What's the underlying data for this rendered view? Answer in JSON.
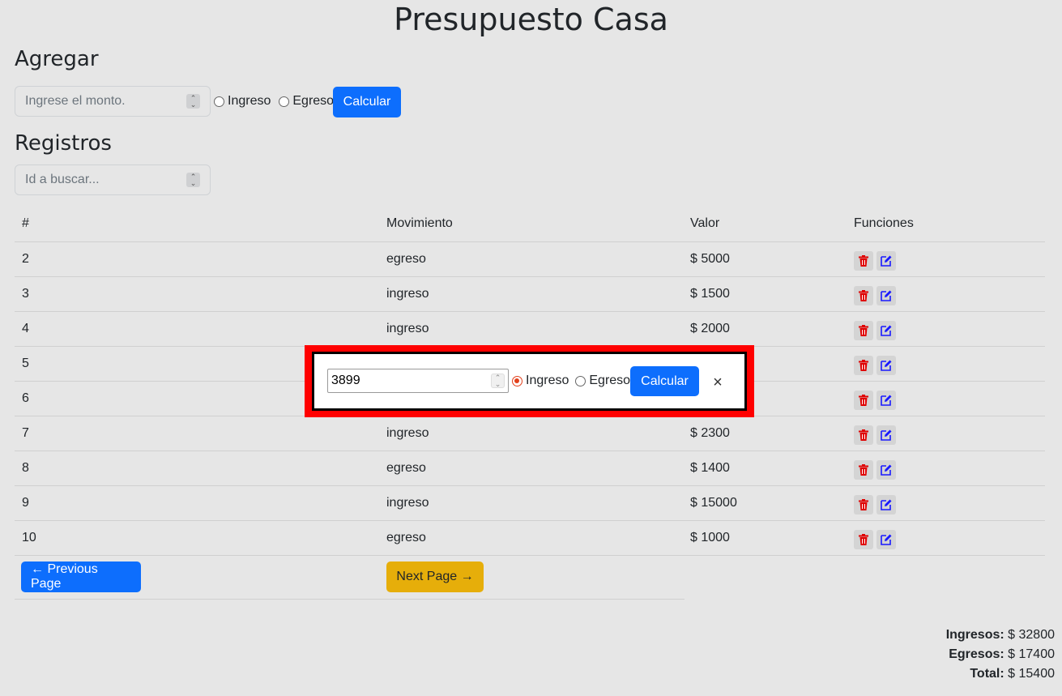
{
  "title": "Presupuesto Casa",
  "add_section": {
    "heading": "Agregar",
    "amount_placeholder": "Ingrese el monto.",
    "option_income": "Ingreso",
    "option_expense": "Egreso",
    "calc_label": "Calcular"
  },
  "records_section": {
    "heading": "Registros",
    "search_placeholder": "Id a buscar..."
  },
  "table": {
    "headers": [
      "#",
      "Movimiento",
      "Valor",
      "Funciones"
    ],
    "rows": [
      {
        "id": "2",
        "type": "egreso",
        "value": "$ 5000"
      },
      {
        "id": "3",
        "type": "ingreso",
        "value": "$ 1500"
      },
      {
        "id": "4",
        "type": "ingreso",
        "value": "$ 2000"
      },
      {
        "id": "5",
        "type": "",
        "value": ""
      },
      {
        "id": "6",
        "type": "",
        "value": ""
      },
      {
        "id": "7",
        "type": "ingreso",
        "value": "$ 2300"
      },
      {
        "id": "8",
        "type": "egreso",
        "value": "$ 1400"
      },
      {
        "id": "9",
        "type": "ingreso",
        "value": "$ 15000"
      },
      {
        "id": "10",
        "type": "egreso",
        "value": "$ 1000"
      }
    ]
  },
  "pager": {
    "prev_label": "← Previous Page",
    "next_label": "Next Page →"
  },
  "totals": {
    "income_label": "Ingresos:",
    "income_value": "$ 32800",
    "expense_label": "Egresos:",
    "expense_value": "$ 17400",
    "total_label": "Total:",
    "total_value": "$ 15400"
  },
  "edit_modal": {
    "amount_value": "3899",
    "option_income": "Ingreso",
    "option_expense": "Egreso",
    "selected": "Ingreso",
    "calc_label": "Calcular",
    "close_symbol": "×"
  },
  "colors": {
    "primary": "#0d6efd",
    "warning": "#e6ae0a",
    "delete_icon": "#e00000",
    "edit_icon": "#1a1aff",
    "modal_border": "#ff0000"
  },
  "icons": {
    "delete": "trash-icon",
    "edit": "edit-icon"
  }
}
